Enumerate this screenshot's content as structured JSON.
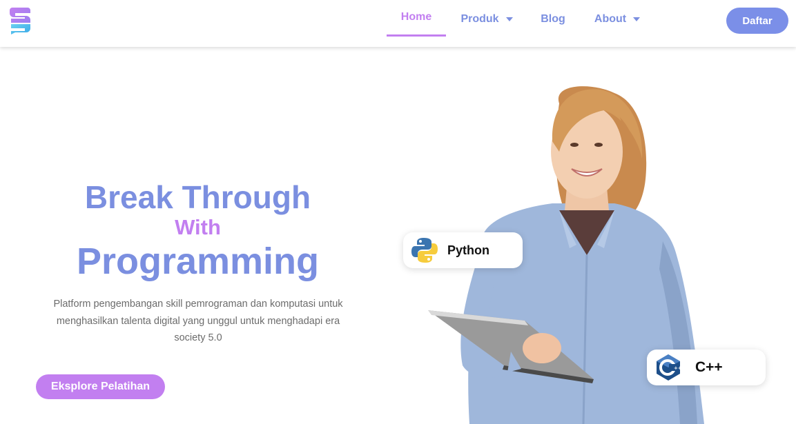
{
  "nav": {
    "items": [
      {
        "label": "Home",
        "active": true,
        "dropdown": false
      },
      {
        "label": "Produk",
        "active": false,
        "dropdown": true
      },
      {
        "label": "Blog",
        "active": false,
        "dropdown": false
      },
      {
        "label": "About",
        "active": false,
        "dropdown": true
      }
    ],
    "cta_label": "Daftar"
  },
  "hero": {
    "title_line1": "Break Through",
    "title_line2": "With",
    "title_line3": "Programming",
    "description": "Platform pengembangan skill pemrograman dan komputasi untuk menghasilkan talenta digital yang unggul untuk menghadapi era society 5.0",
    "cta_label": "Eksplore Pelatihan"
  },
  "badges": [
    {
      "label": "Python",
      "icon": "python-logo-icon"
    },
    {
      "label": "C++",
      "icon": "cpp-logo-icon"
    }
  ],
  "colors": {
    "primary_blue": "#7b8fe0",
    "accent_purple": "#c27ff0",
    "button_blue": "#7b8fe8",
    "text_gray": "#6b6b6b"
  }
}
